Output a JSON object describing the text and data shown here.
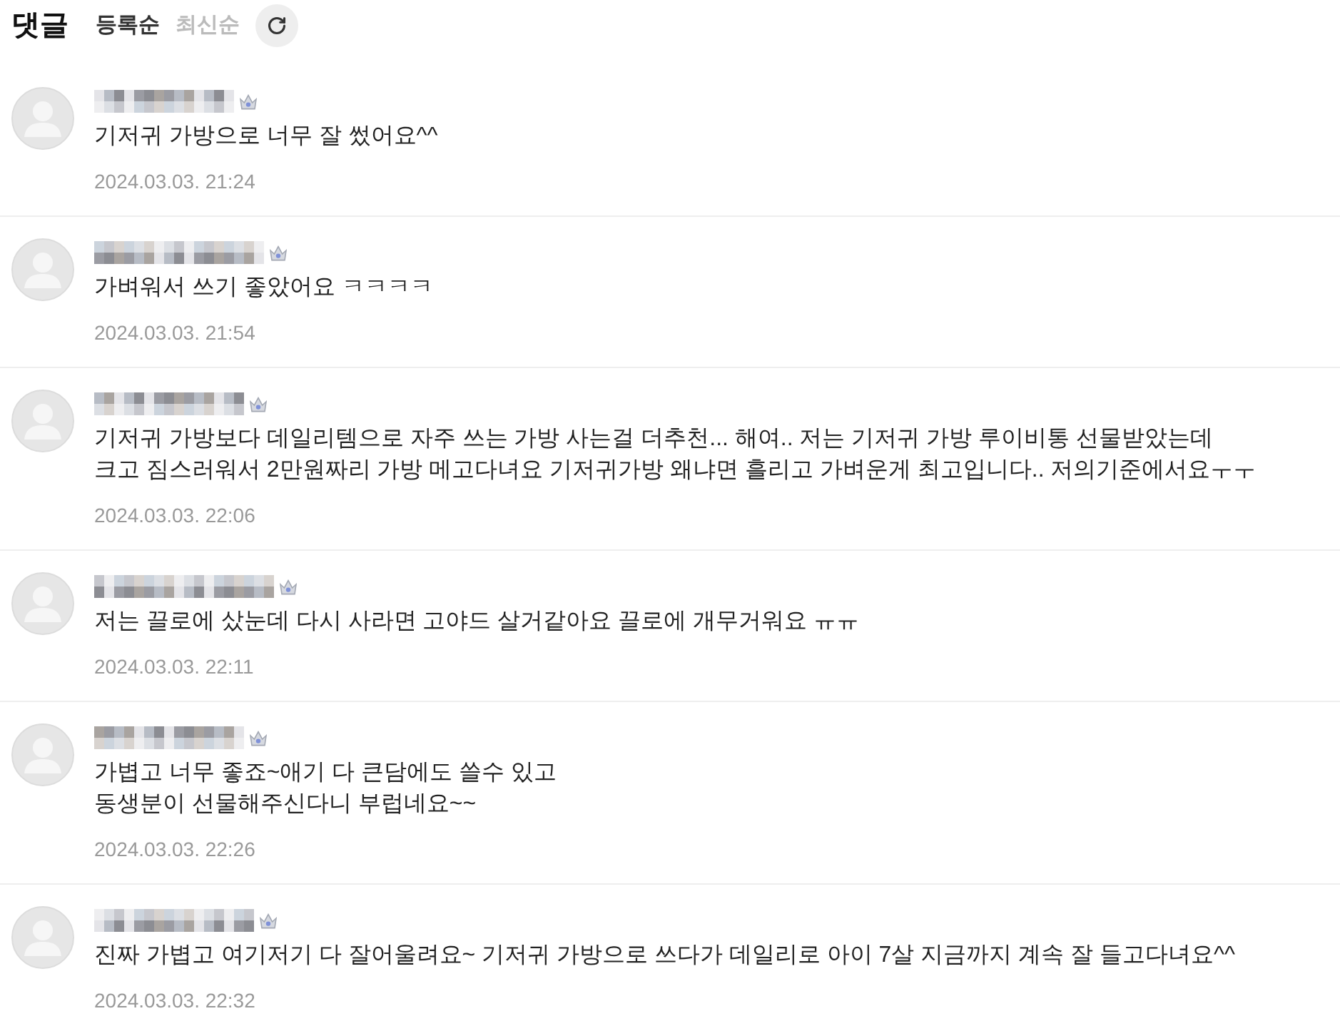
{
  "header": {
    "title": "댓글",
    "sort_options": [
      {
        "label": "등록순",
        "selected": true
      },
      {
        "label": "최신순",
        "selected": false
      }
    ]
  },
  "comments": [
    {
      "text": "기저귀 가방으로 너무 잘 썼어요^^",
      "date": "2024.03.03. 21:24"
    },
    {
      "text": "가벼워서 쓰기 좋았어요 ㅋㅋㅋㅋ",
      "date": "2024.03.03. 21:54"
    },
    {
      "text": "기저귀 가방보다 데일리템으로 자주 쓰는 가방 사는걸 더추천... 해여.. 저는 기저귀 가방 루이비통 선물받았는데\n크고 짐스러워서 2만원짜리 가방 메고다녀요 기저귀가방 왜냐면 흘리고 가벼운게 최고입니다.. 저의기준에서요ㅜㅜ",
      "date": "2024.03.03. 22:06"
    },
    {
      "text": "저는 끌로에 샀눈데 다시 사라면 고야드 살거같아요 끌로에 개무거워요 ㅠㅠ",
      "date": "2024.03.03. 22:11"
    },
    {
      "text": "가볍고 너무 좋죠~애기 다 큰담에도 쓸수 있고\n동생분이 선물해주신다니 부럽네요~~",
      "date": "2024.03.03. 22:26"
    },
    {
      "text": "진짜 가볍고 여기저기 다 잘어울려요~ 기저귀 가방으로 쓰다가 데일리로 아이 7살 지금까지 계속 잘 들고다녀요^^",
      "date": "2024.03.03. 22:32"
    }
  ]
}
